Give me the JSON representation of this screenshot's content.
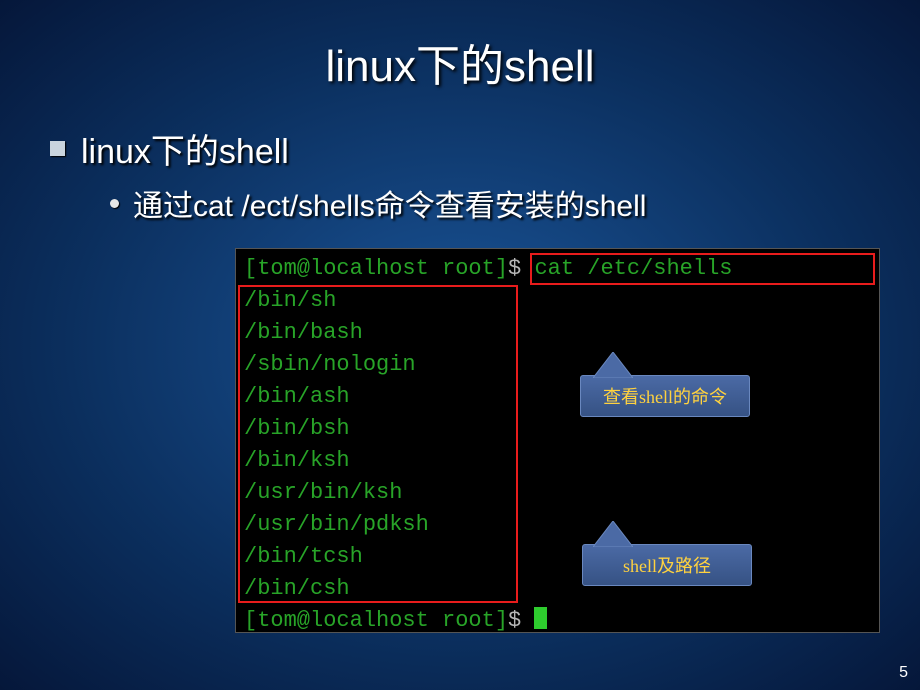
{
  "title": "linux下的shell",
  "bullet1": "linux下的shell",
  "bullet2": "通过cat /ect/shells命令查看安装的shell",
  "terminal": {
    "prompt1_host": "[tom@localhost root]",
    "prompt1_sep": "$ ",
    "prompt1_cmd": "cat /etc/shells",
    "shells": [
      "/bin/sh",
      "/bin/bash",
      "/sbin/nologin",
      "/bin/ash",
      "/bin/bsh",
      "/bin/ksh",
      "/usr/bin/ksh",
      "/usr/bin/pdksh",
      "/bin/tcsh",
      "/bin/csh"
    ],
    "prompt2_host": "[tom@localhost root]",
    "prompt2_sep": "$ "
  },
  "callout1": "查看shell的命令",
  "callout2": "shell及路径",
  "page_number": "5"
}
